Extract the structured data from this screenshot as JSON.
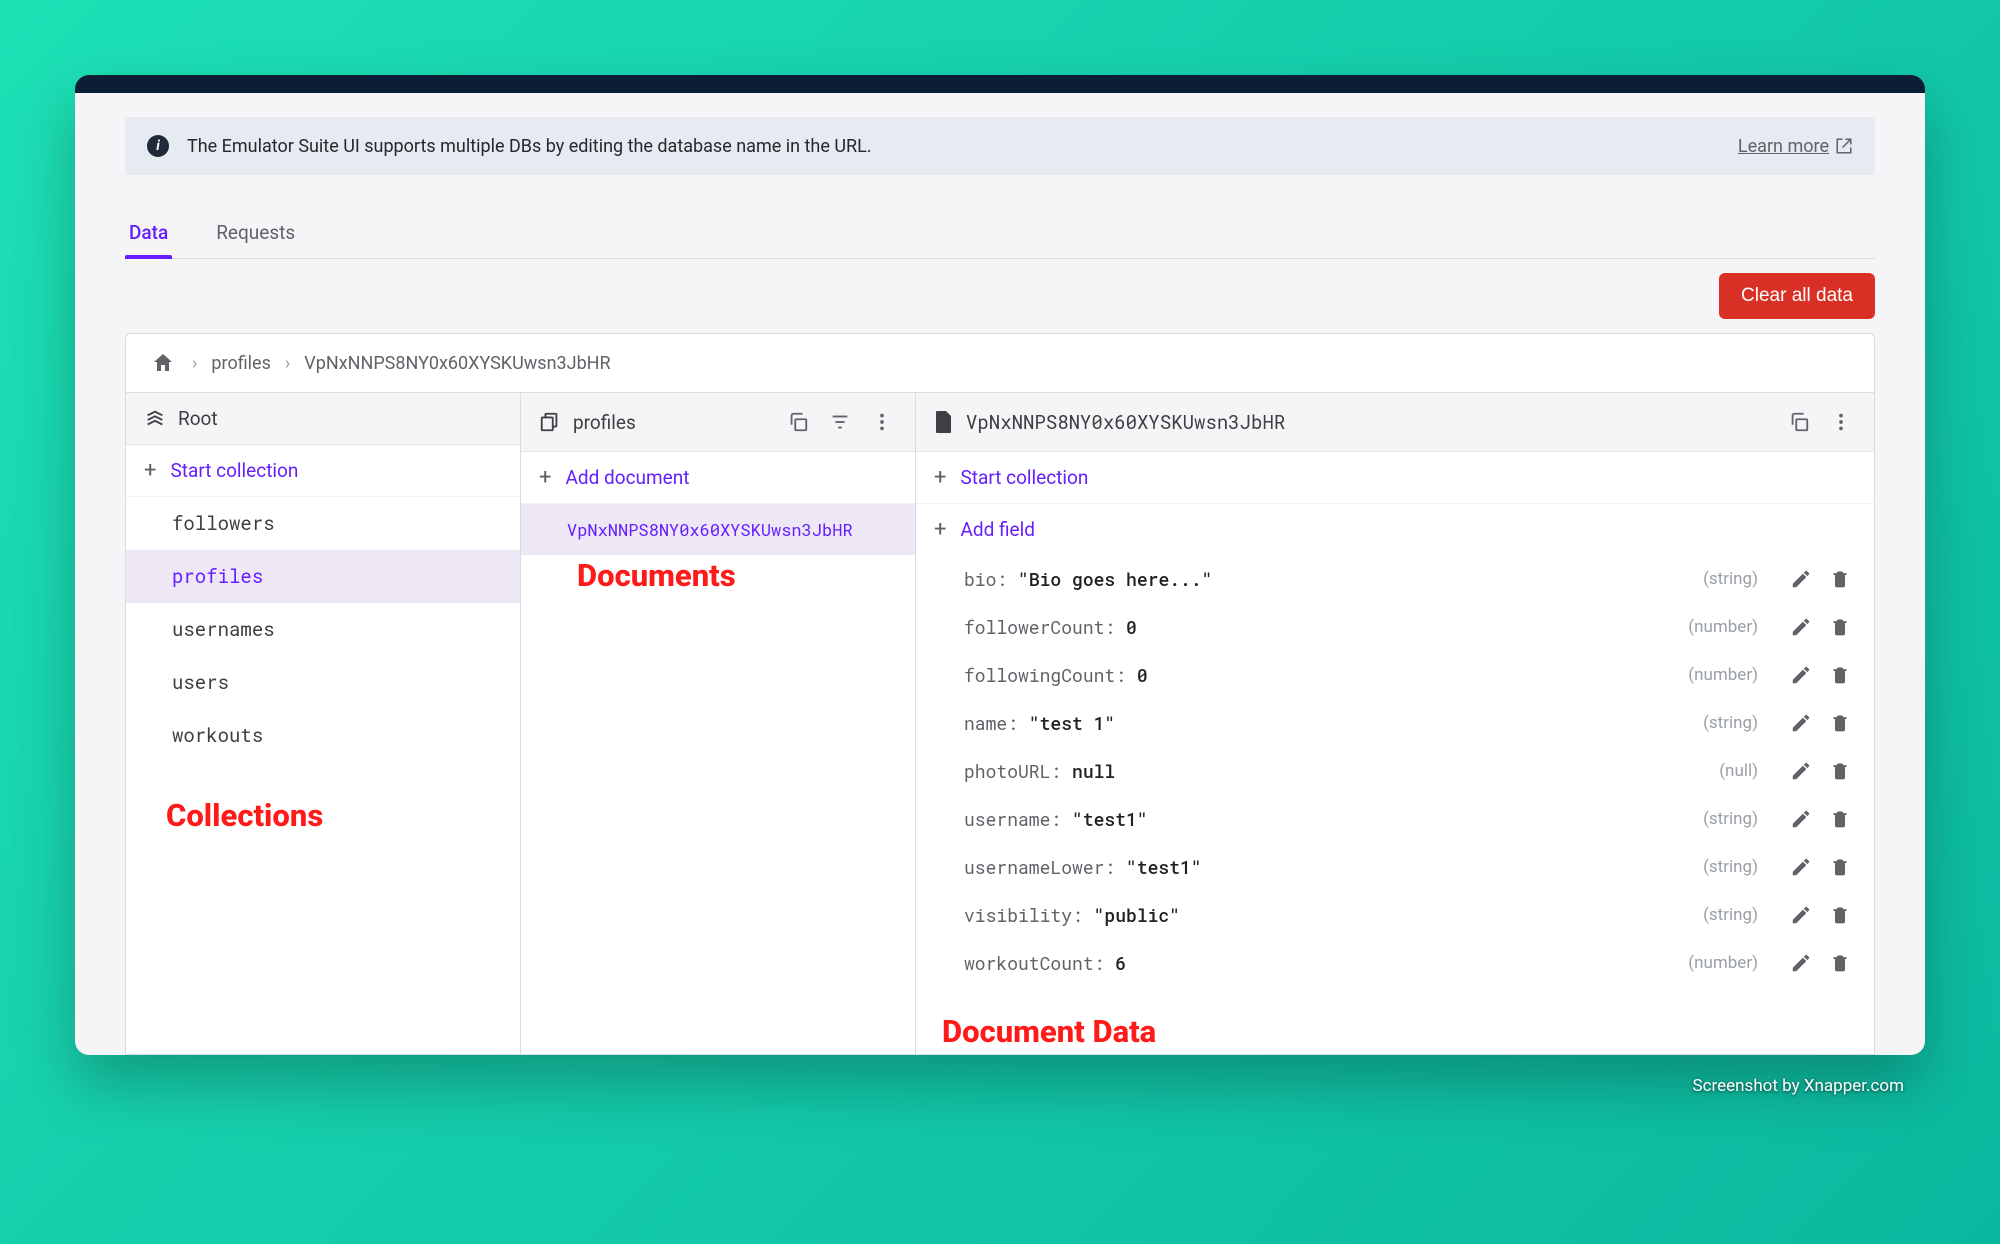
{
  "banner": {
    "text": "The Emulator Suite UI supports multiple DBs by editing the database name in the URL.",
    "link": "Learn more"
  },
  "tabs": {
    "data": "Data",
    "requests": "Requests"
  },
  "actions": {
    "clear": "Clear all data"
  },
  "breadcrumb": {
    "seg1": "profiles",
    "seg2": "VpNxNNPS8NY0x60XYSKUwsn3JbHR"
  },
  "pane1": {
    "title": "Root",
    "action": "Start collection",
    "items": [
      "followers",
      "profiles",
      "usernames",
      "users",
      "workouts"
    ],
    "selectedIndex": 1
  },
  "pane2": {
    "title": "profiles",
    "action": "Add document",
    "items": [
      "VpNxNNPS8NY0x60XYSKUwsn3JbHR"
    ],
    "selectedIndex": 0
  },
  "pane3": {
    "title": "VpNxNNPS8NY0x60XYSKUwsn3JbHR",
    "action1": "Start collection",
    "action2": "Add field",
    "fields": [
      {
        "key": "bio",
        "val": "\"Bio goes here...\"",
        "type": "(string)"
      },
      {
        "key": "followerCount",
        "val": "0",
        "type": "(number)"
      },
      {
        "key": "followingCount",
        "val": "0",
        "type": "(number)"
      },
      {
        "key": "name",
        "val": "\"test 1\"",
        "type": "(string)"
      },
      {
        "key": "photoURL",
        "val": "null",
        "type": "(null)"
      },
      {
        "key": "username",
        "val": "\"test1\"",
        "type": "(string)"
      },
      {
        "key": "usernameLower",
        "val": "\"test1\"",
        "type": "(string)"
      },
      {
        "key": "visibility",
        "val": "\"public\"",
        "type": "(string)"
      },
      {
        "key": "workoutCount",
        "val": "6",
        "type": "(number)"
      }
    ]
  },
  "annotations": {
    "collections": "Collections",
    "documents": "Documents",
    "docdata": "Document Data"
  },
  "watermark": "Screenshot by Xnapper.com"
}
